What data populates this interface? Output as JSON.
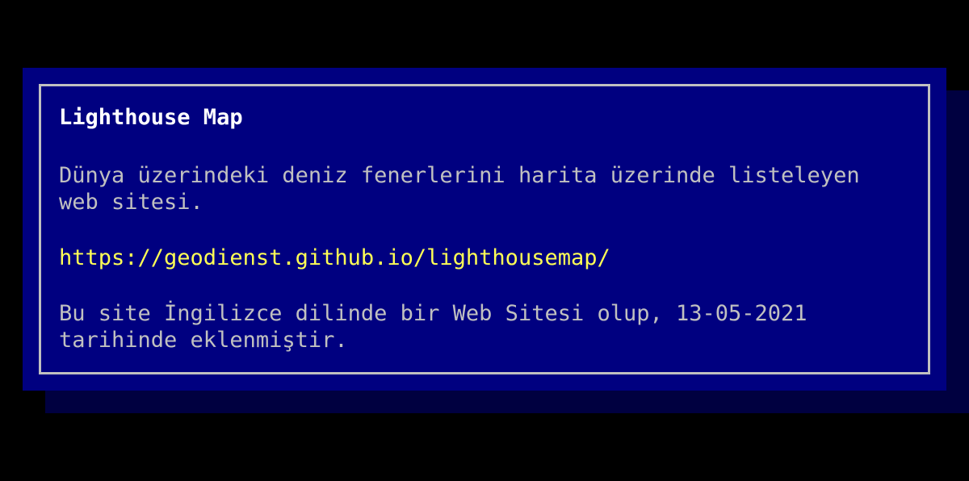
{
  "window": {
    "title": "Lighthouse Map"
  },
  "content": {
    "description": "Dünya üzerindeki deniz fenerlerini harita üzerinde listeleyen web sitesi.",
    "url": "https://geodienst.github.io/lighthousemap/",
    "info": "Bu site İngilizce dilinde bir Web Sitesi olup, 13-05-2021 tarihinde eklenmiştir."
  },
  "colors": {
    "background": "#000000",
    "dialog": "#000080",
    "shadow": "#000040",
    "border": "#c0c0c0",
    "title": "#ffffff",
    "text": "#c0c0c0",
    "link": "#ffff55"
  }
}
